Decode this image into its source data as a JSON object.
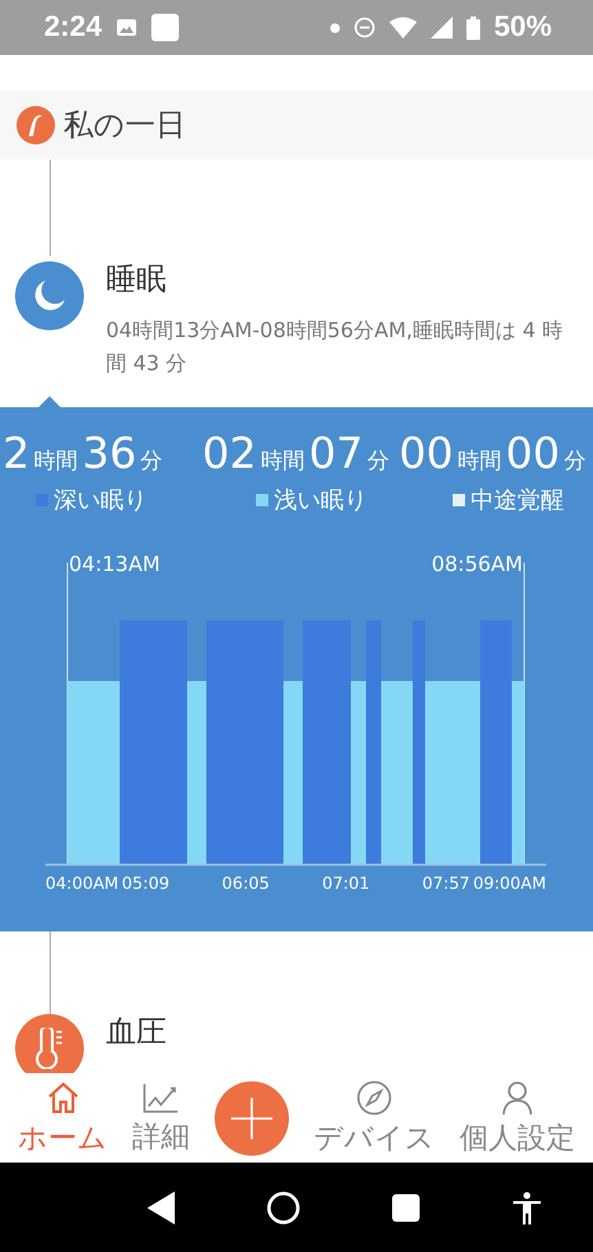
{
  "status_bar": {
    "time": "2:24",
    "battery": "50%"
  },
  "section": {
    "title": "私の一日"
  },
  "timeline": [
    {
      "kind": "sleep",
      "title": "睡眠",
      "description": "04時間13分AM-08時間56分AM,睡眠時間は 4 時間 43 分"
    },
    {
      "kind": "blood_pressure",
      "title": "血圧"
    }
  ],
  "sleep_report": {
    "stats": [
      {
        "hours": "2",
        "hours_unit": "時間",
        "minutes": "36",
        "minutes_unit": "分",
        "label": "深い眠り",
        "color": "#3d7bdc"
      },
      {
        "hours": "02",
        "hours_unit": "時間",
        "minutes": "07",
        "minutes_unit": "分",
        "label": "浅い眠り",
        "color": "#84d8f6"
      },
      {
        "hours": "00",
        "hours_unit": "時間",
        "minutes": "00",
        "minutes_unit": "分",
        "label": "中途覚醒",
        "color": "#e8eef8"
      }
    ],
    "sleep_chart": {
      "start_label": "04:13AM",
      "end_label": "08:56AM",
      "axis_labels": [
        "04:00AM",
        "05:09",
        "06:05",
        "07:01",
        "07:57",
        "09:00AM"
      ]
    }
  },
  "nav": {
    "items": [
      {
        "kind": "home",
        "label": "ホーム",
        "selected": true
      },
      {
        "kind": "chart",
        "label": "詳細",
        "selected": false
      },
      {
        "kind": "compass",
        "label": "デバイス",
        "selected": false
      },
      {
        "kind": "person",
        "label": "個人設定",
        "selected": false
      }
    ]
  }
}
